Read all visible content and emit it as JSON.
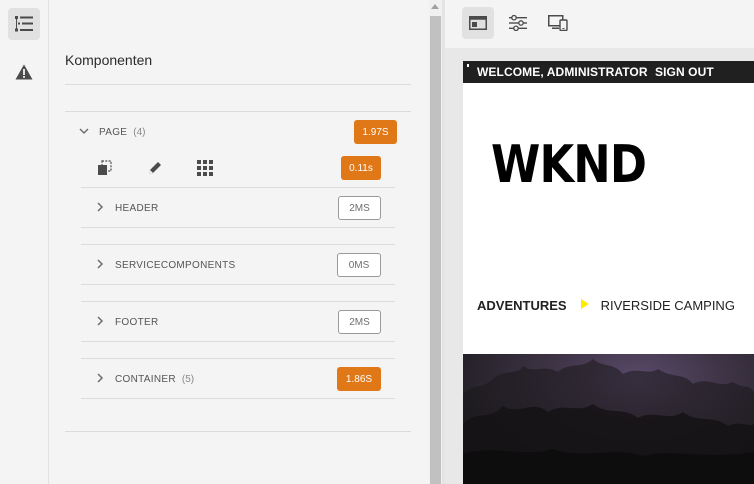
{
  "panel": {
    "title": "Komponenten"
  },
  "page_row": {
    "label": "PAGE",
    "count": "(4)",
    "time": "1.97S",
    "tools_time": "0.11s"
  },
  "rows": [
    {
      "label": "HEADER",
      "count": "",
      "time": "2MS",
      "status": "normal"
    },
    {
      "label": "SERVICECOMPONENTS",
      "count": "",
      "time": "0MS",
      "status": "normal"
    },
    {
      "label": "FOOTER",
      "count": "",
      "time": "2MS",
      "status": "normal"
    },
    {
      "label": "CONTAINER",
      "count": "(5)",
      "time": "1.86S",
      "status": "slow"
    }
  ],
  "preview": {
    "welcome": "WELCOME, ADMINISTRATOR",
    "sign_out": "SIGN OUT",
    "logo": "WKND",
    "breadcrumb_1": "ADVENTURES",
    "breadcrumb_2": "RIVERSIDE CAMPING"
  },
  "icons": {
    "rail": [
      "component-tree-icon",
      "alert-icon"
    ],
    "toolbar": [
      "page-info-icon",
      "settings-sliders-icon",
      "device-emulator-icon"
    ],
    "page_tools": [
      "copy-icon",
      "edit-pencil-icon",
      "grid-icon"
    ]
  },
  "colors": {
    "slow_badge": "#e07818",
    "breadcrumb_arrow": "#ffea00"
  }
}
